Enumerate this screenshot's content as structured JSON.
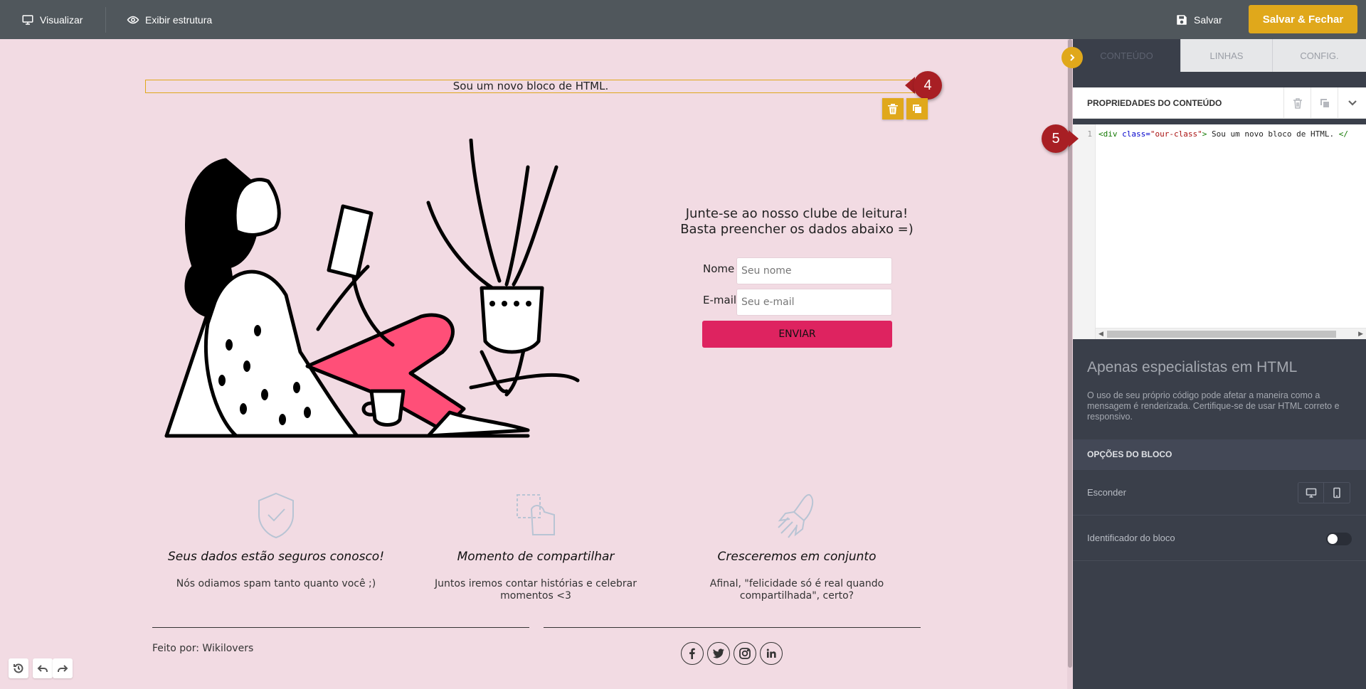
{
  "toolbar": {
    "preview_label": "Visualizar",
    "structure_label": "Exibir estrutura",
    "save_label": "Salvar",
    "save_close_label": "Salvar & Fechar"
  },
  "canvas": {
    "html_block_text": "Sou um novo bloco de HTML.",
    "callout_4": "4",
    "callout_5": "5",
    "signup": {
      "title_line1": "Junte-se ao nosso clube de leitura!",
      "title_line2": "Basta preencher os dados abaixo =)",
      "name_label": "Nome",
      "name_placeholder": "Seu nome",
      "email_label": "E-mail",
      "email_placeholder": "Seu e-mail",
      "submit_label": "ENVIAR"
    },
    "features": [
      {
        "title": "Seus dados estão seguros conosco!",
        "text": "Nós odiamos spam tanto quanto você ;)"
      },
      {
        "title": "Momento de compartilhar",
        "text": "Juntos iremos contar histórias e celebrar momentos <3"
      },
      {
        "title": "Cresceremos em conjunto",
        "text": "Afinal, \"felicidade só é real quando compartilhada\", certo?"
      }
    ],
    "footer_credit": "Feito por: Wikilovers",
    "social_icons": [
      "facebook-icon",
      "twitter-icon",
      "instagram-icon",
      "linkedin-icon"
    ]
  },
  "panel": {
    "tabs": [
      {
        "label": "CONTEÚDO",
        "active": true
      },
      {
        "label": "LINHAS",
        "active": false
      },
      {
        "label": "CONFIG.",
        "active": false
      }
    ],
    "properties_title": "PROPRIEDADES DO CONTEÚDO",
    "code": {
      "line_number": "1",
      "open_tag": "<div",
      "attr_name": " class=",
      "attr_value": "\"our-class\"",
      "tag_close": ">",
      "text": " Sou um novo bloco de HTML. ",
      "close_tag": "</"
    },
    "warning_title": "Apenas especialistas em HTML",
    "warning_text": "O uso de seu próprio código pode afetar a maneira como a mensagem é renderizada. Certifique-se de usar HTML correto e responsivo.",
    "block_options_title": "OPÇÕES DO BLOCO",
    "hide_label": "Esconder",
    "block_id_label": "Identificador do bloco"
  },
  "colors": {
    "accent": "#e0a81b",
    "canvas_bg": "#f2dbe3",
    "submit_bg": "#de2360",
    "callout": "#a81f24",
    "panel_bg": "#3a3f4a"
  }
}
